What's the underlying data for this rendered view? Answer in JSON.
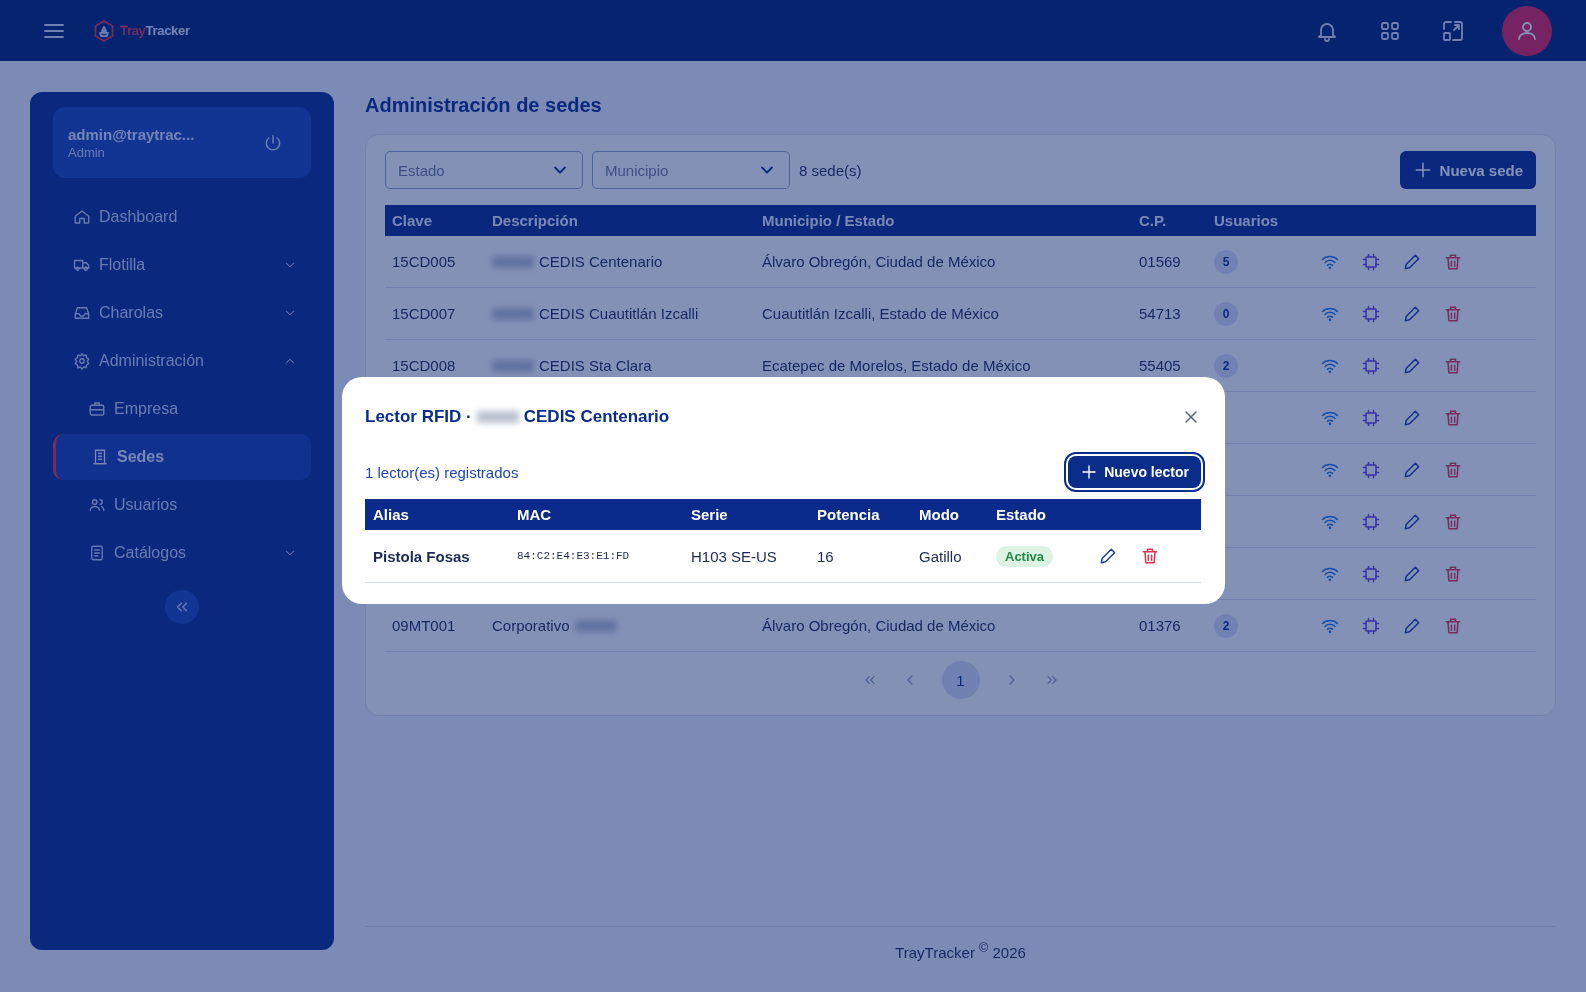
{
  "header": {
    "brand_part1": "Tray",
    "brand_part2": "Tracker"
  },
  "sidebar": {
    "user": {
      "email": "admin@traytrac...",
      "role": "Admin"
    },
    "nav": [
      {
        "label": "Dashboard",
        "selected": false
      },
      {
        "label": "Flotilla",
        "selected": false,
        "expanded": false
      },
      {
        "label": "Charolas",
        "selected": false,
        "expanded": false
      },
      {
        "label": "Administración",
        "selected": false,
        "expanded": true,
        "children": [
          {
            "label": "Empresa",
            "selected": false
          },
          {
            "label": "Sedes",
            "selected": true
          },
          {
            "label": "Usuarios",
            "selected": false
          },
          {
            "label": "Catálogos",
            "selected": false,
            "expanded": false
          }
        ]
      }
    ]
  },
  "main": {
    "title": "Administración de sedes",
    "filters": [
      {
        "placeholder": "Estado"
      },
      {
        "placeholder": "Municipio"
      }
    ],
    "count": "8 sede(s)",
    "new_button": "Nueva sede",
    "table": {
      "columns": [
        "Clave",
        "Descripción",
        "Municipio / Estado",
        "C.P.",
        "Usuarios"
      ],
      "rows": [
        {
          "covered": false,
          "clave": "15CD005",
          "descripcion": "CEDIS Centenario",
          "blur_before": true,
          "blur_after": false,
          "municipio": "Álvaro Obregón, Ciudad de México",
          "cp": "01569",
          "usuarios": "5"
        },
        {
          "covered": false,
          "clave": "15CD007",
          "descripcion": "CEDIS Cuautitlán Izcalli",
          "blur_before": true,
          "blur_after": false,
          "municipio": "Cuautitlán Izcalli, Estado de México",
          "cp": "54713",
          "usuarios": "0"
        },
        {
          "covered": false,
          "clave": "15CD008",
          "descripcion": "CEDIS Sta Clara",
          "blur_before": true,
          "blur_after": false,
          "municipio": "Ecatepec de Morelos, Estado de México",
          "cp": "55405",
          "usuarios": "2"
        },
        {
          "covered": true
        },
        {
          "covered": true
        },
        {
          "covered": true
        },
        {
          "covered": true
        },
        {
          "covered": false,
          "clave": "09MT001",
          "descripcion": "Corporativo",
          "blur_before": false,
          "blur_after": true,
          "municipio": "Álvaro Obregón, Ciudad de México",
          "cp": "01376",
          "usuarios": "2"
        }
      ]
    },
    "pagination": {
      "pages": [
        {
          "label": "1",
          "selected": true
        }
      ]
    }
  },
  "footer": "TrayTracker $^{©}$ 2026",
  "modal": {
    "title_prefix": "Lector RFID ·",
    "title_name": "CEDIS Centenario",
    "title_redacted": true,
    "count": "1 lector(es) registrados",
    "new_button": "Nuevo lector",
    "columns": [
      "Alias",
      "MAC",
      "Serie",
      "Potencia",
      "Modo",
      "Estado"
    ],
    "rows": [
      {
        "alias": "Pistola Fosas",
        "mac": "84:C2:E4:E3:E1:FD",
        "serie": "H103 SE-US",
        "potencia": "16",
        "modo": "Gatillo",
        "estado": {
          "label": "Activa",
          "kind": "active"
        }
      }
    ]
  }
}
